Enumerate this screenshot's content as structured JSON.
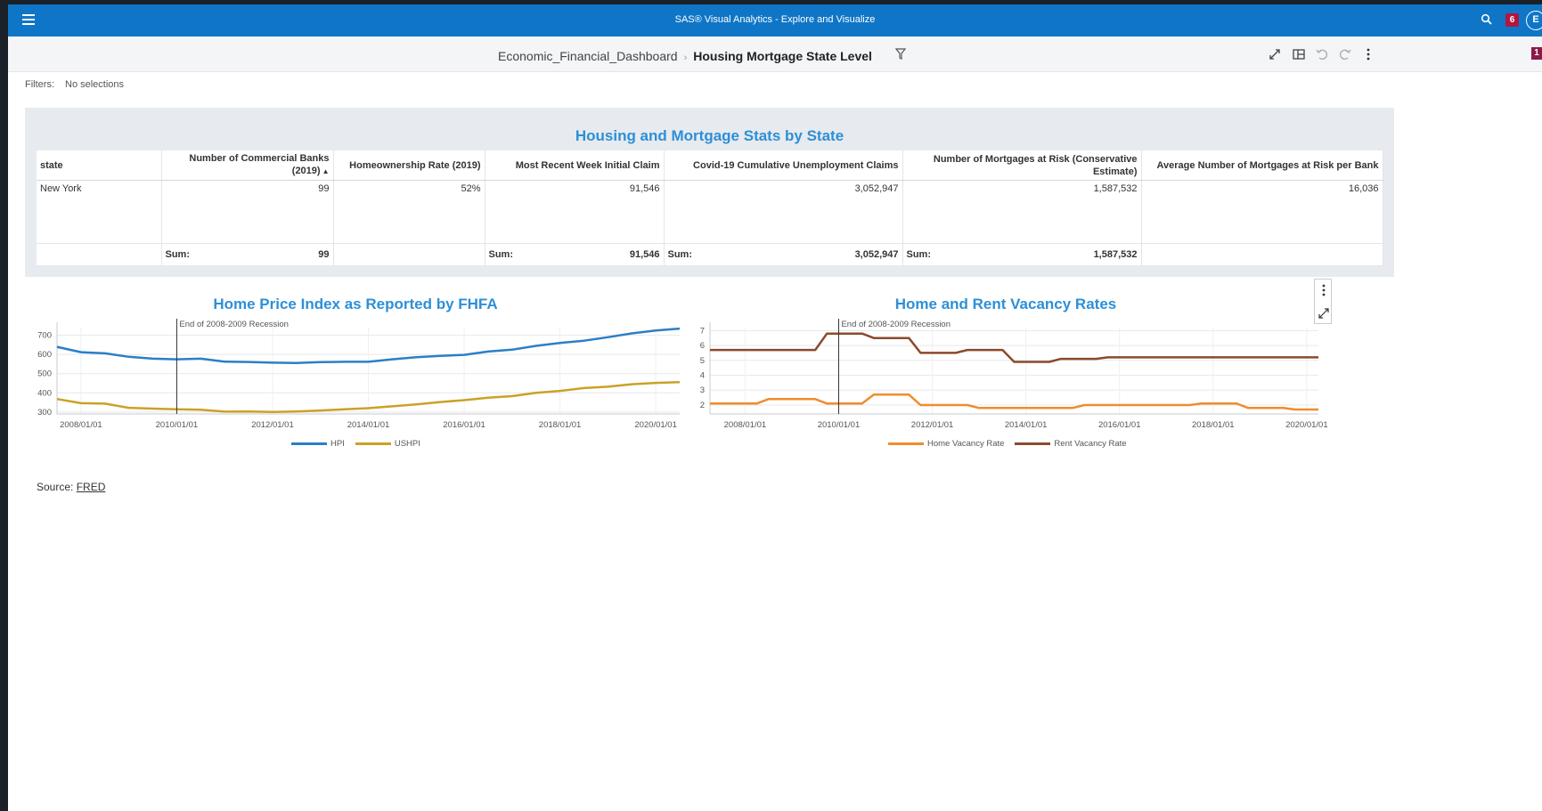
{
  "topbar": {
    "app_title": "SAS® Visual Analytics - Explore and Visualize",
    "notification_count": "6",
    "avatar_initial": "E",
    "colors": {
      "bar": "#0f76c7",
      "badge": "#b3163d"
    }
  },
  "subheader": {
    "breadcrumb_root": "Economic_Financial_Dashboard",
    "breadcrumb_current": "Housing Mortgage State Level",
    "page_badge": "1"
  },
  "filters": {
    "label": "Filters:",
    "value": "No selections"
  },
  "table": {
    "title": "Housing and Mortgage Stats by State",
    "columns": [
      "state",
      "Number of Commercial Banks (2019)",
      "Homeownership Rate (2019)",
      "Most Recent Week Initial Claim",
      "Covid-19 Cumulative Unemployment Claims",
      "Number of Mortgages at Risk (Conservative Estimate)",
      "Average Number of Mortgages at Risk per Bank"
    ],
    "rows": [
      [
        "New York",
        "99",
        "52%",
        "91,546",
        "3,052,947",
        "1,587,532",
        "16,036"
      ]
    ],
    "sum_label": "Sum:",
    "sums": [
      "",
      "99",
      "",
      "91,546",
      "3,052,947",
      "1,587,532",
      ""
    ]
  },
  "chart_data": [
    {
      "type": "line",
      "title": "Home Price Index as Reported by FHFA",
      "x": [
        "2007/07/01",
        "2008/01/01",
        "2008/07/01",
        "2009/01/01",
        "2009/07/01",
        "2010/01/01",
        "2010/07/01",
        "2011/01/01",
        "2011/07/01",
        "2012/01/01",
        "2012/07/01",
        "2013/01/01",
        "2013/07/01",
        "2014/01/01",
        "2014/07/01",
        "2015/01/01",
        "2015/07/01",
        "2016/01/01",
        "2016/07/01",
        "2017/01/01",
        "2017/07/01",
        "2018/01/01",
        "2018/07/01",
        "2019/01/01",
        "2019/07/01",
        "2020/01/01",
        "2020/07/01"
      ],
      "x_ticks": [
        "2008/01/01",
        "2010/01/01",
        "2012/01/01",
        "2014/01/01",
        "2016/01/01",
        "2018/01/01",
        "2020/01/01"
      ],
      "series": [
        {
          "name": "HPI",
          "color": "#2b7fc6",
          "values": [
            640,
            612,
            606,
            588,
            578,
            575,
            578,
            563,
            561,
            557,
            556,
            560,
            562,
            562,
            575,
            586,
            593,
            598,
            615,
            625,
            645,
            660,
            672,
            690,
            710,
            725,
            735
          ]
        },
        {
          "name": "USHPI",
          "color": "#c9a227",
          "values": [
            368,
            346,
            344,
            322,
            318,
            314,
            312,
            302,
            303,
            300,
            303,
            308,
            314,
            320,
            330,
            340,
            352,
            362,
            375,
            383,
            400,
            410,
            425,
            432,
            445,
            452,
            456
          ]
        }
      ],
      "ylim": [
        290,
        740
      ],
      "y_ticks": [
        300,
        400,
        500,
        600,
        700
      ],
      "annotation": {
        "x": "2010/01/01",
        "label": "End of 2008-2009 Recession"
      },
      "grid": true,
      "legend": "bottom"
    },
    {
      "type": "line",
      "title": "Home and Rent Vacancy Rates",
      "x": [
        "2007/04/01",
        "2007/07/01",
        "2007/10/01",
        "2008/01/01",
        "2008/04/01",
        "2008/07/01",
        "2008/10/01",
        "2009/01/01",
        "2009/04/01",
        "2009/07/01",
        "2009/10/01",
        "2010/01/01",
        "2010/04/01",
        "2010/07/01",
        "2010/10/01",
        "2011/01/01",
        "2011/04/01",
        "2011/07/01",
        "2011/10/01",
        "2012/01/01",
        "2012/04/01",
        "2012/07/01",
        "2012/10/01",
        "2013/01/01",
        "2013/04/01",
        "2013/07/01",
        "2013/10/01",
        "2014/01/01",
        "2014/04/01",
        "2014/07/01",
        "2014/10/01",
        "2015/01/01",
        "2015/04/01",
        "2015/07/01",
        "2015/10/01",
        "2016/01/01",
        "2016/04/01",
        "2016/07/01",
        "2016/10/01",
        "2017/01/01",
        "2017/04/01",
        "2017/07/01",
        "2017/10/01",
        "2018/01/01",
        "2018/04/01",
        "2018/07/01",
        "2018/10/01",
        "2019/01/01",
        "2019/04/01",
        "2019/07/01",
        "2019/10/01",
        "2020/01/01",
        "2020/04/01"
      ],
      "x_ticks": [
        "2008/01/01",
        "2010/01/01",
        "2012/01/01",
        "2014/01/01",
        "2016/01/01",
        "2018/01/01",
        "2020/01/01"
      ],
      "series": [
        {
          "name": "Home Vacancy Rate",
          "color": "#f08c2e",
          "values": [
            2.1,
            2.1,
            2.1,
            2.1,
            2.1,
            2.4,
            2.4,
            2.4,
            2.4,
            2.4,
            2.1,
            2.1,
            2.1,
            2.1,
            2.7,
            2.7,
            2.7,
            2.7,
            2.0,
            2.0,
            2.0,
            2.0,
            2.0,
            1.8,
            1.8,
            1.8,
            1.8,
            1.8,
            1.8,
            1.8,
            1.8,
            1.8,
            2.0,
            2.0,
            2.0,
            2.0,
            2.0,
            2.0,
            2.0,
            2.0,
            2.0,
            2.0,
            2.1,
            2.1,
            2.1,
            2.1,
            1.8,
            1.8,
            1.8,
            1.8,
            1.7,
            1.7,
            1.7
          ]
        },
        {
          "name": "Rent Vacancy Rate",
          "color": "#8b4a2b",
          "values": [
            5.7,
            5.7,
            5.7,
            5.7,
            5.7,
            5.7,
            5.7,
            5.7,
            5.7,
            5.7,
            6.8,
            6.8,
            6.8,
            6.8,
            6.5,
            6.5,
            6.5,
            6.5,
            5.5,
            5.5,
            5.5,
            5.5,
            5.7,
            5.7,
            5.7,
            5.7,
            4.9,
            4.9,
            4.9,
            4.9,
            5.1,
            5.1,
            5.1,
            5.1,
            5.2,
            5.2,
            5.2,
            5.2,
            5.2,
            5.2,
            5.2,
            5.2,
            5.2,
            5.2,
            5.2,
            5.2,
            5.2,
            5.2,
            5.2,
            5.2,
            5.2,
            5.2,
            5.2
          ]
        }
      ],
      "ylim": [
        1.4,
        7.2
      ],
      "y_ticks": [
        2,
        3,
        4,
        5,
        6,
        7
      ],
      "annotation": {
        "x": "2010/01/01",
        "label": "End of 2008-2009 Recession"
      },
      "grid": true,
      "legend": "bottom"
    }
  ],
  "source": {
    "label": "Source:",
    "link": "FRED"
  }
}
